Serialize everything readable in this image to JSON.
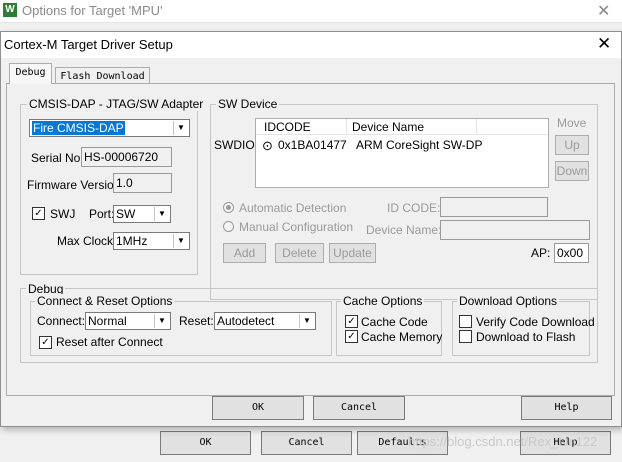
{
  "parent": {
    "title": "Options for Target 'MPU'",
    "app_icon": "W",
    "buttons": {
      "ok": "OK",
      "cancel": "Cancel",
      "defaults": "Defaults",
      "help": "Help"
    }
  },
  "dialog": {
    "title": "Cortex-M Target Driver Setup",
    "tabs": [
      "Debug",
      "Flash Download"
    ],
    "adapter": {
      "group_label": "CMSIS-DAP - JTAG/SW Adapter",
      "selected": "Fire CMSIS-DAP",
      "serial_label": "Serial No:",
      "serial_value": "HS-00006720",
      "firmware_label": "Firmware Version:",
      "firmware_value": "1.0",
      "swj_label": "SWJ",
      "swj_checked": true,
      "port_label": "Port:",
      "port_value": "SW",
      "maxclock_label": "Max Clock:",
      "maxclock_value": "1MHz"
    },
    "sw_device": {
      "group_label": "SW Device",
      "swdio_label": "SWDIO",
      "columns": [
        "IDCODE",
        "Device Name"
      ],
      "rows": [
        {
          "idcode": "0x1BA01477",
          "device_name": "ARM CoreSight SW-DP"
        }
      ],
      "move_label": "Move",
      "up_label": "Up",
      "down_label": "Down",
      "auto_detection": "Automatic Detection",
      "manual_configuration": "Manual Configuration",
      "id_code_label": "ID CODE:",
      "device_name_label": "Device Name:",
      "add": "Add",
      "delete": "Delete",
      "update": "Update",
      "ap_label": "AP:",
      "ap_value": "0x00"
    },
    "debug": {
      "group_label": "Debug",
      "connect_reset": {
        "group_label": "Connect & Reset Options",
        "connect_label": "Connect:",
        "connect_value": "Normal",
        "reset_label": "Reset:",
        "reset_value": "Autodetect",
        "reset_after_connect": "Reset after Connect"
      },
      "cache": {
        "group_label": "Cache Options",
        "cache_code": "Cache Code",
        "cache_memory": "Cache Memory"
      },
      "download": {
        "group_label": "Download Options",
        "verify": "Verify Code Download",
        "download_flash": "Download to Flash"
      }
    },
    "buttons": {
      "ok": "OK",
      "cancel": "Cancel",
      "help": "Help"
    }
  },
  "watermark": "https://blog.csdn.net/Rex_Lin122"
}
